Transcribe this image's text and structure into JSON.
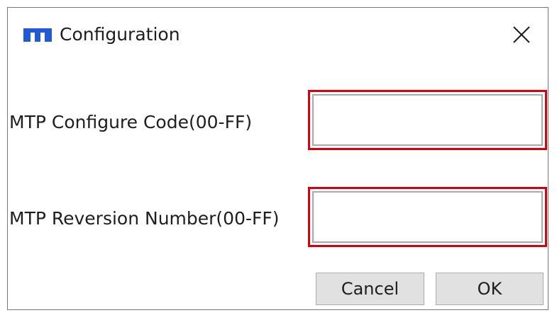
{
  "window": {
    "title": "Configuration",
    "app_icon": "app-logo-icon",
    "close_icon": "close-icon"
  },
  "fields": [
    {
      "label": "MTP Configure Code(00-FF)",
      "value": "",
      "placeholder": ""
    },
    {
      "label": "MTP Reversion Number(00-FF)",
      "value": "",
      "placeholder": ""
    }
  ],
  "buttons": {
    "cancel_label": "Cancel",
    "ok_label": "OK"
  },
  "colors": {
    "highlight": "#d7000f",
    "brand": "#1f5bd6"
  }
}
